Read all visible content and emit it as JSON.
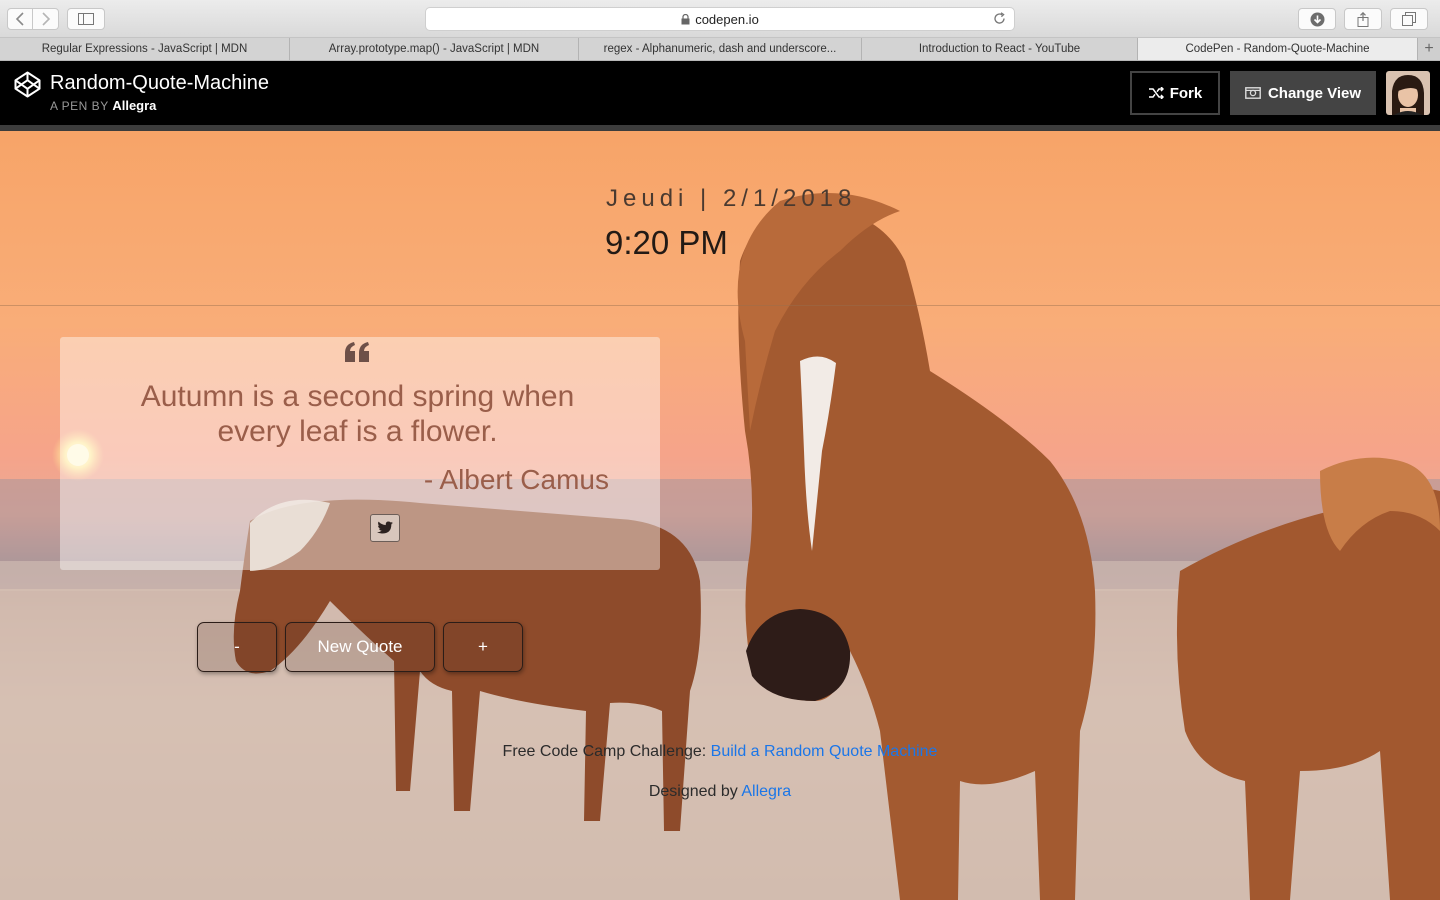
{
  "browser": {
    "url": "codepen.io",
    "tabs": [
      {
        "label": "Regular Expressions - JavaScript | MDN",
        "active": false
      },
      {
        "label": "Array.prototype.map() - JavaScript | MDN",
        "active": false
      },
      {
        "label": "regex - Alphanumeric, dash and underscore...",
        "active": false
      },
      {
        "label": "Introduction to React - YouTube",
        "active": false
      },
      {
        "label": "CodePen - Random-Quote-Machine",
        "active": true
      }
    ],
    "new_tab_label": "+"
  },
  "codepen": {
    "pen_title": "Random-Quote-Machine",
    "byline_prefix": "A PEN BY",
    "author": "Allegra",
    "fork_label": "Fork",
    "change_view_label": "Change View"
  },
  "page": {
    "date": "Jeudi | 2/1/2018",
    "time": "9:20 PM",
    "quote": "Autumn is a second spring when every leaf is a flower.",
    "author": "- Albert Camus",
    "buttons": {
      "minus": "-",
      "new_quote": "New Quote",
      "plus": "+"
    },
    "footer": {
      "challenge_prefix": "Free Code Camp Challenge: ",
      "challenge_link": "Build a Random Quote Machine",
      "designed_prefix": "Designed by ",
      "designer_link": "Allegra"
    }
  },
  "colors": {
    "link": "#1b76e8",
    "quote_text": "#9a5e4a",
    "header_bg": "#000000"
  },
  "icons": [
    "back-icon",
    "forward-icon",
    "sidebar-icon",
    "lock-icon",
    "reload-icon",
    "download-icon",
    "share-icon",
    "tabs-overview-icon",
    "codepen-logo-icon",
    "fork-icon",
    "change-view-icon",
    "quote-mark-icon",
    "twitter-icon"
  ]
}
